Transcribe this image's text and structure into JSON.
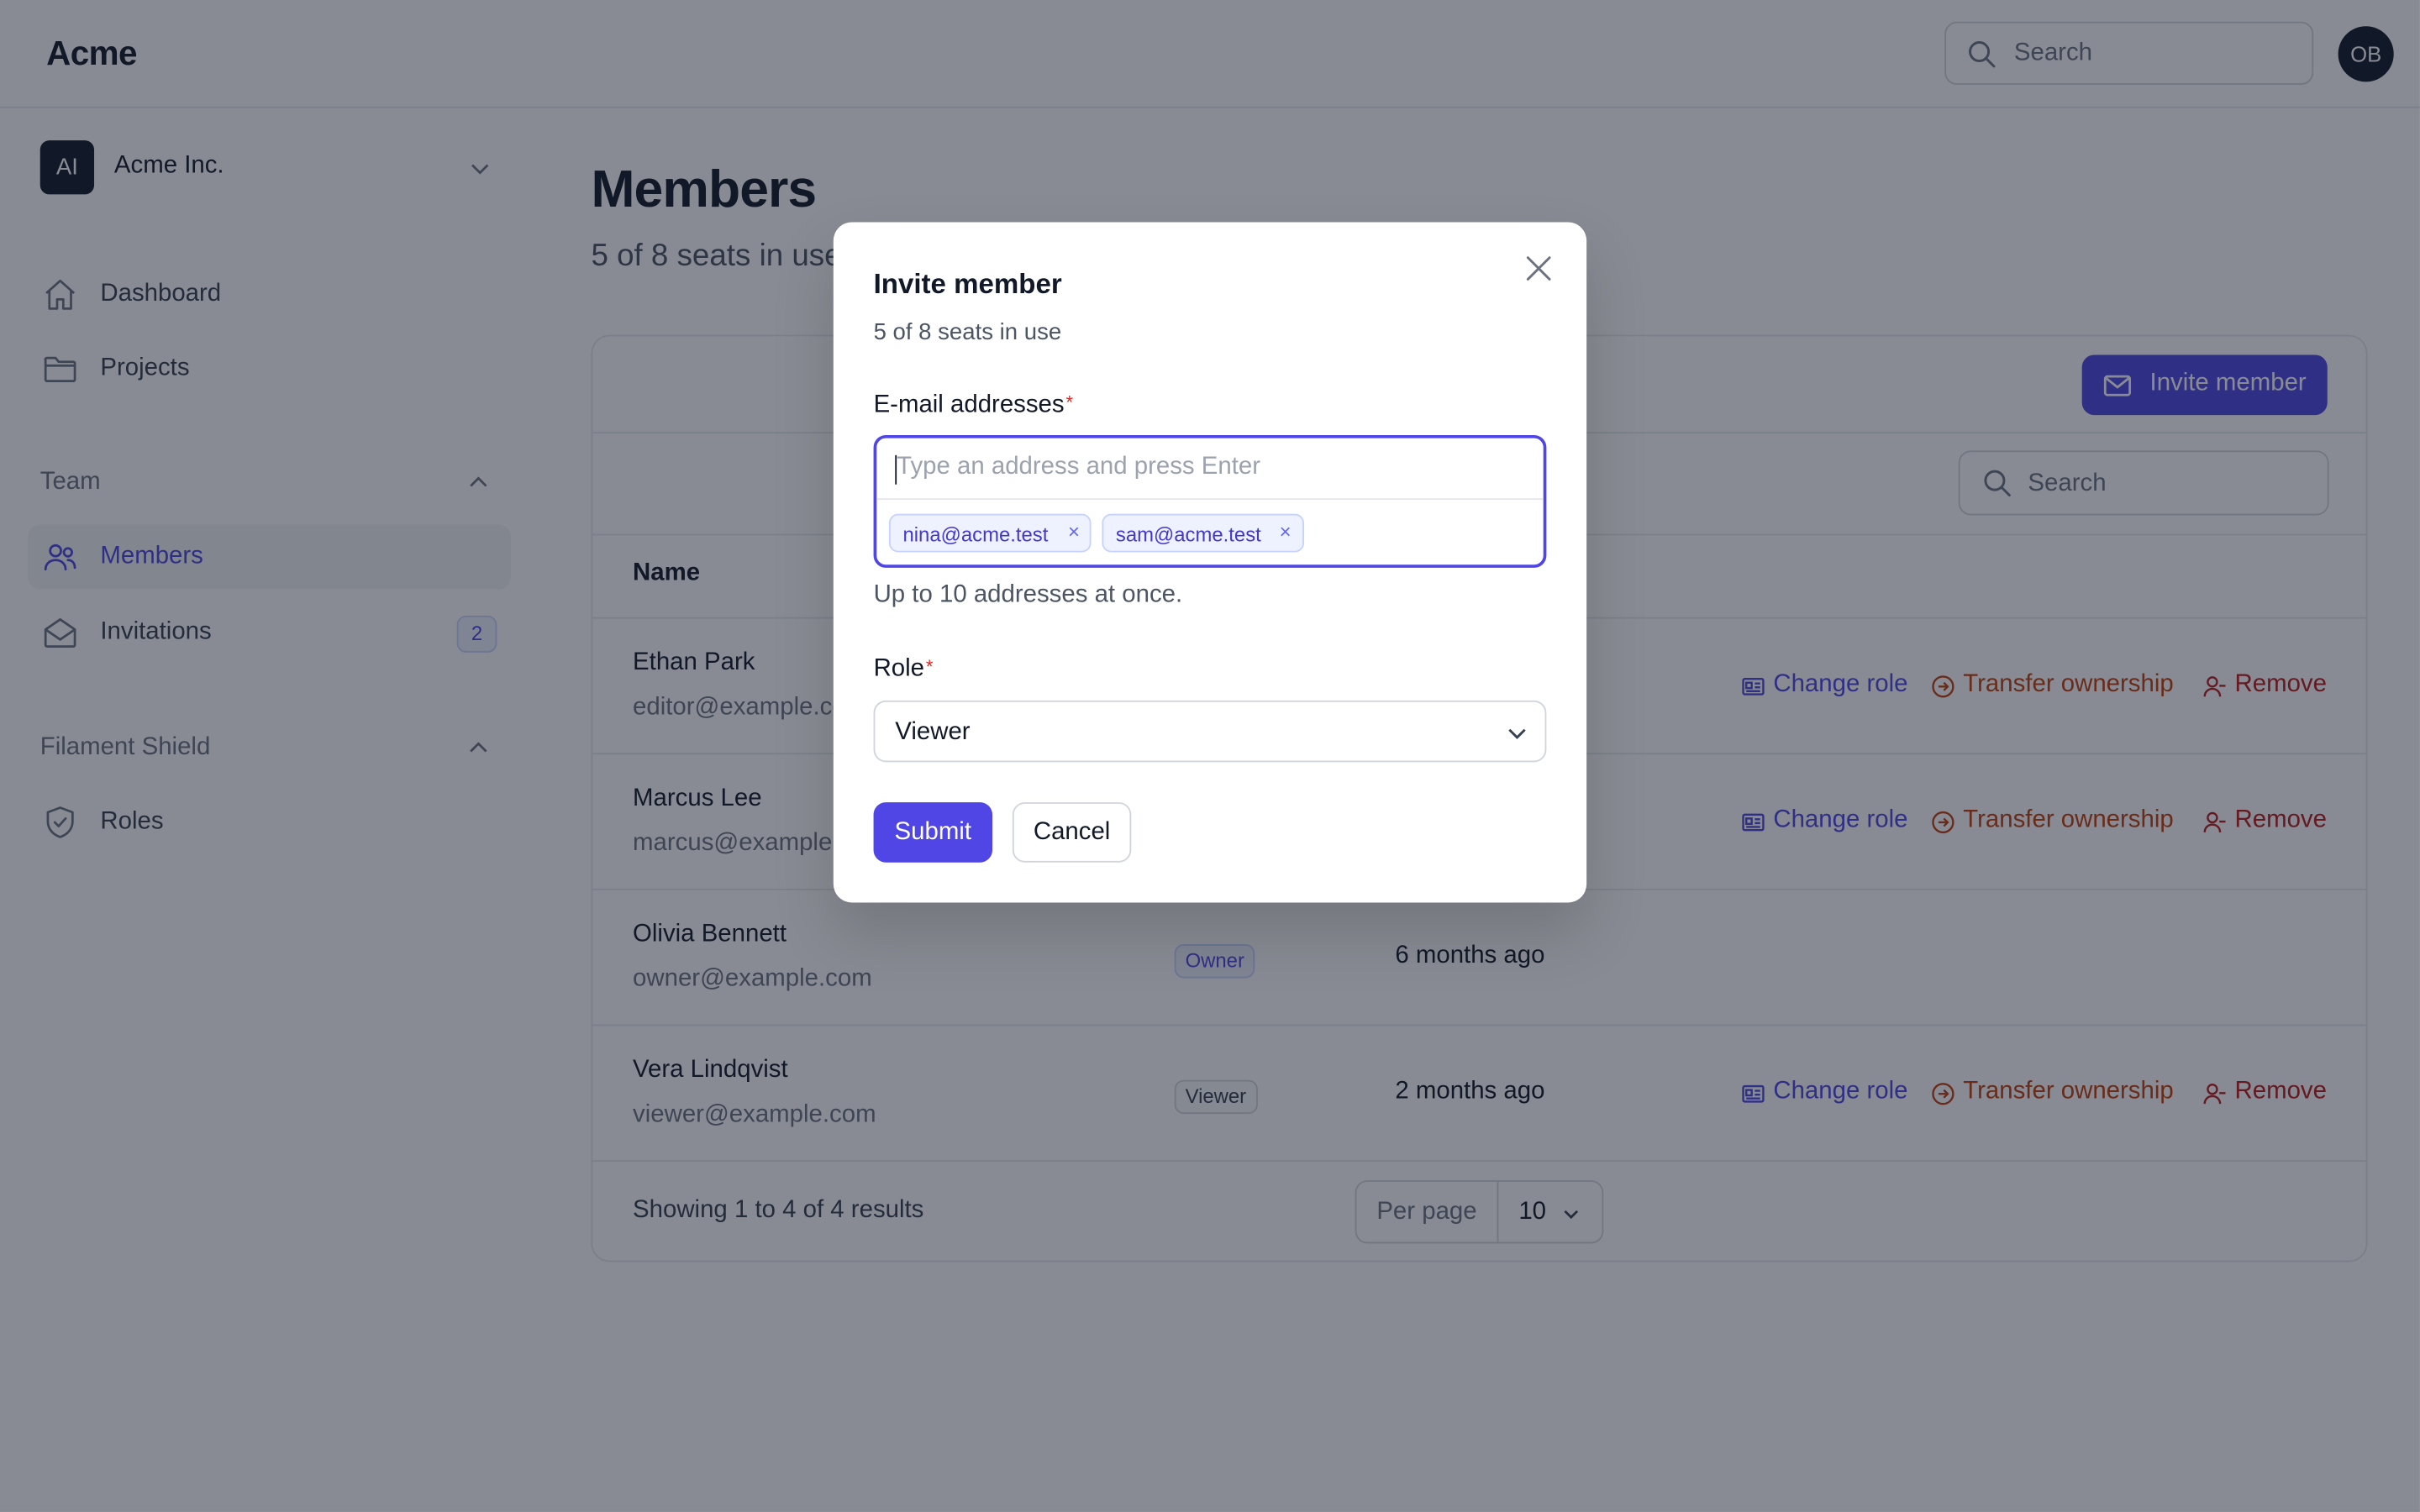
{
  "app": {
    "brand": "Acme"
  },
  "topbar": {
    "search_placeholder": "Search",
    "avatar_initials": "OB"
  },
  "sidebar": {
    "tenant": {
      "initials": "AI",
      "name": "Acme Inc."
    },
    "items": [
      {
        "label": "Dashboard",
        "icon": "home-icon"
      },
      {
        "label": "Projects",
        "icon": "folder-icon"
      }
    ],
    "groups": [
      {
        "label": "Team",
        "items": [
          {
            "label": "Members",
            "icon": "users-icon",
            "active": true
          },
          {
            "label": "Invitations",
            "icon": "envelope-open-icon",
            "badge": "2"
          }
        ]
      },
      {
        "label": "Filament Shield",
        "items": [
          {
            "label": "Roles",
            "icon": "shield-check-icon"
          }
        ]
      }
    ]
  },
  "main": {
    "title": "Members",
    "subtitle": "5 of 8 seats in use",
    "invite_button": "Invite member",
    "table_search_placeholder": "Search",
    "columns": [
      "Name"
    ],
    "rows": [
      {
        "name": "Ethan Park",
        "email": "editor@example.com",
        "role": "",
        "joined": "",
        "actions": true
      },
      {
        "name": "Marcus Lee",
        "email": "marcus@example.com",
        "role": "",
        "joined": "",
        "actions": true
      },
      {
        "name": "Olivia Bennett",
        "email": "owner@example.com",
        "role": "Owner",
        "joined": "6 months ago",
        "actions": false
      },
      {
        "name": "Vera Lindqvist",
        "email": "viewer@example.com",
        "role": "Viewer",
        "joined": "2 months ago",
        "actions": true
      }
    ],
    "actions": {
      "change_role": "Change role",
      "transfer": "Transfer ownership",
      "remove": "Remove"
    },
    "footer": {
      "showing": "Showing 1 to 4 of 4 results",
      "per_page_label": "Per page",
      "per_page_value": "10"
    }
  },
  "modal": {
    "title": "Invite member",
    "subtitle": "5 of 8 seats in use",
    "email_label": "E-mail addresses",
    "required_mark": "*",
    "email_placeholder": "Type an address and press Enter",
    "emails": [
      "nina@acme.test",
      "sam@acme.test"
    ],
    "chip_remove": "×",
    "email_hint": "Up to 10 addresses at once.",
    "role_label": "Role",
    "role_value": "Viewer",
    "submit": "Submit",
    "cancel": "Cancel"
  },
  "colors": {
    "primary": "#4f46e5",
    "warning": "#c2410c",
    "danger": "#b91c1c",
    "overlay": "rgba(17,24,39,0.5)"
  }
}
